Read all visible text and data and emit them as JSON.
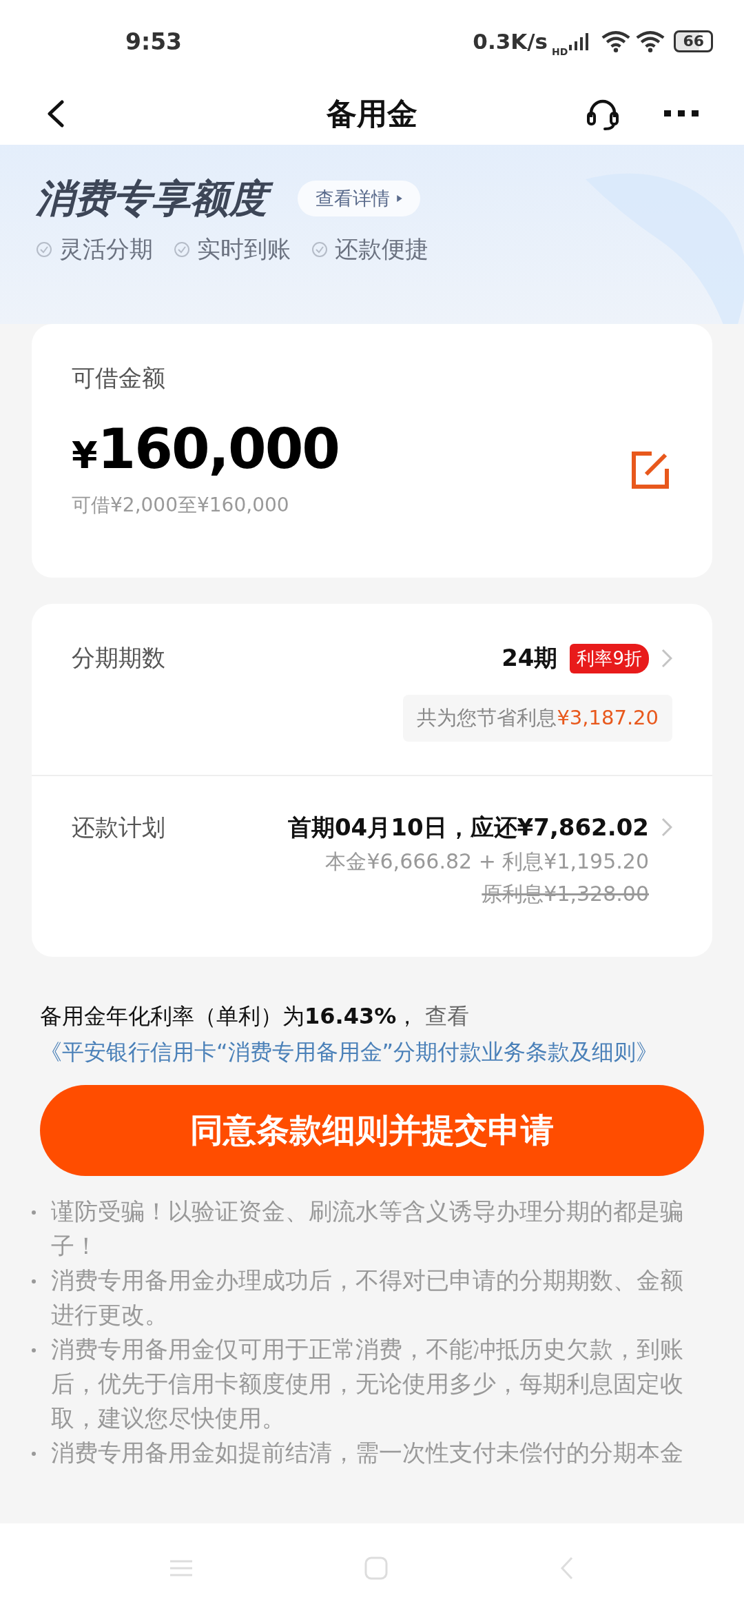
{
  "status_bar": {
    "time": "9:53",
    "speed": "0.3K/s",
    "signal_label": "HD",
    "battery": "66"
  },
  "header": {
    "title": "备用金"
  },
  "hero": {
    "title": "消费专享额度",
    "details_link": "查看详情",
    "features": [
      "灵活分期",
      "实时到账",
      "还款便捷"
    ]
  },
  "amount_card": {
    "label": "可借金额",
    "currency": "¥",
    "amount": "160,000",
    "range": "可借¥2,000至¥160,000"
  },
  "term_row": {
    "label": "分期期数",
    "value": "24期",
    "badge": "利率9折",
    "savings_label": "共为您节省利息",
    "savings_amount": "¥3,187.20"
  },
  "plan_row": {
    "label": "还款计划",
    "first_payment": "首期04月10日，应还¥7,862.02",
    "breakdown": "本金¥6,666.82 + 利息¥1,195.20",
    "original_interest": "原利息¥1,328.00"
  },
  "terms": {
    "text": "备用金年化利率（单利）为**16.43%**，",
    "view": "查看",
    "link": "《平安银行信用卡“消费专用备用金”分期付款业务条款及细则》"
  },
  "submit_button": "同意条款细则并提交申请",
  "notes": [
    "谨防受骗！以验证资金、刷流水等含义诱导办理分期的都是骗子！",
    "消费专用备用金办理成功后，不得对已申请的分期期数、金额进行更改。",
    "消费专用备用金仅可用于正常消费，不能冲抵历史欠款，到账后，优先于信用卡额度使用，无论使用多少，每期利息固定收取，建议您尽快使用。",
    "消费专用备用金如提前结清，需一次性支付未偿付的分期本金"
  ]
}
